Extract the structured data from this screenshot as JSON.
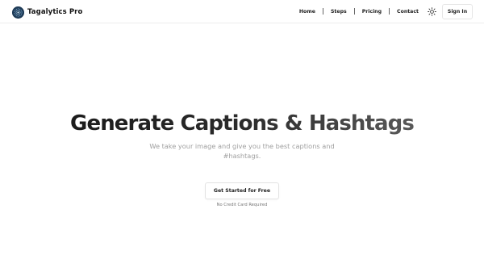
{
  "brand": {
    "name": "Tagalytics Pro",
    "logo_color": "#1f3b57"
  },
  "nav": {
    "items": [
      {
        "label": "Home"
      },
      {
        "label": "Steps"
      },
      {
        "label": "Pricing"
      },
      {
        "label": "Contact"
      }
    ],
    "theme_icon": "sun-icon",
    "signin_label": "Sign In"
  },
  "hero": {
    "title": "Generate Captions & Hashtags",
    "subtitle_line1": "We take your image and give you the best captions and",
    "subtitle_line2": "#hashtags.",
    "cta_label": "Get Started for Free",
    "cta_note": "No Credit Card Required"
  }
}
